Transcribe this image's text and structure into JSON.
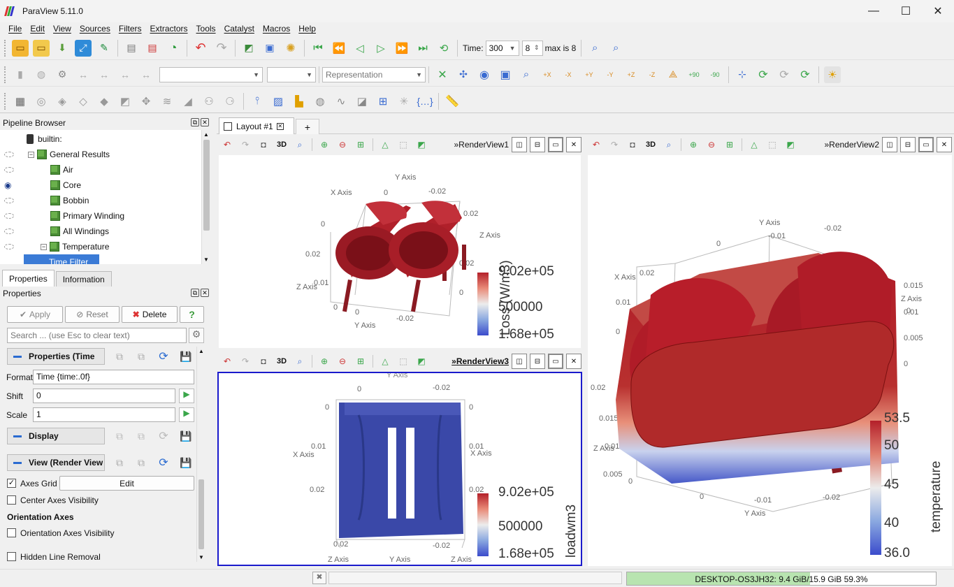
{
  "window": {
    "title": "ParaView 5.11.0",
    "minimize": "—",
    "maximize": "☐",
    "close": "✕"
  },
  "menu": [
    "File",
    "Edit",
    "View",
    "Sources",
    "Filters",
    "Extractors",
    "Tools",
    "Catalyst",
    "Macros",
    "Help"
  ],
  "time_toolbar": {
    "time_label": "Time:",
    "time_value": "300",
    "step_value": "8",
    "max_label": "max is 8"
  },
  "toolbar2": {
    "representation_placeholder": "Representation",
    "camera_labels": [
      "+X",
      "-X",
      "+Y",
      "-Y",
      "+Z",
      "-Z",
      "+90",
      "-90"
    ]
  },
  "pipeline": {
    "header": "Pipeline Browser",
    "items": [
      {
        "label": "builtin:",
        "visible": null
      },
      {
        "label": "General Results",
        "visible": false
      },
      {
        "label": "Air",
        "visible": false
      },
      {
        "label": "Core",
        "visible": true
      },
      {
        "label": "Bobbin",
        "visible": false
      },
      {
        "label": "Primary Winding",
        "visible": false
      },
      {
        "label": "All Windings",
        "visible": false
      },
      {
        "label": "Temperature",
        "visible": false
      },
      {
        "label": "Time Filter",
        "visible": false,
        "selected": true
      }
    ]
  },
  "props_tabs": {
    "properties": "Properties",
    "information": "Information"
  },
  "properties": {
    "header": "Properties",
    "apply": "Apply",
    "reset": "Reset",
    "delete": "Delete",
    "help": "?",
    "search_placeholder": "Search ... (use Esc to clear text)",
    "section_props": "Properties (Time",
    "format_label": "Format",
    "format_value": "Time {time:.0f}",
    "shift_label": "Shift",
    "shift_value": "0",
    "scale_label": "Scale",
    "scale_value": "1",
    "section_display": "Display",
    "section_view": "View (Render View",
    "axes_grid": "Axes Grid",
    "edit": "Edit",
    "center_axes": "Center Axes Visibility",
    "orientation_heading": "Orientation Axes",
    "orientation_vis": "Orientation Axes Visibility",
    "hidden_line": "Hidden Line Removal"
  },
  "layout": {
    "tab": "Layout #1",
    "add": "+"
  },
  "views": {
    "rv1": {
      "name": "RenderView1",
      "scalar_title": "Loss (W/m3)",
      "max": "9.02e+05",
      "mid": "500000",
      "min": "1.68e+05"
    },
    "rv2": {
      "name": "RenderView2",
      "scalar_title": "temperature",
      "t535": "53.5",
      "t50": "50",
      "t45": "45",
      "t40": "40",
      "t36": "36.0"
    },
    "rv3": {
      "name": "RenderView3",
      "scalar_title": "loadwm3",
      "max": "9.02e+05",
      "mid": "500000",
      "min": "1.68e+05"
    },
    "toolbar_3d": "3D",
    "axis_x": "X Axis",
    "axis_y": "Y Axis",
    "axis_z": "Z Axis"
  },
  "status": {
    "memory": "DESKTOP-OS3JH32: 9.4 GiB/15.9 GiB 59.3%",
    "memory_fraction": 0.593
  },
  "colors": {
    "accent": "#2a6bd1",
    "selection": "#3b7bd6",
    "active_view_border": "#1a1acc",
    "mesh_red": "#a8202a",
    "core_blue": "#3a48a8"
  }
}
